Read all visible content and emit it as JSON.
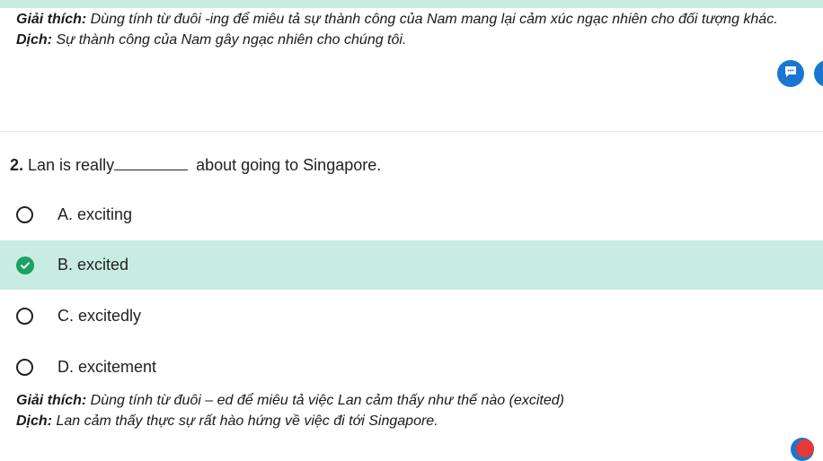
{
  "previous": {
    "explanation_label": "Giải thích:",
    "explanation_text": " Dùng tính từ đuôi -ing để miêu tả sự thành công của Nam mang lại cảm xúc ngạc nhiên cho đối tượng khác.",
    "translation_label": "Dịch:",
    "translation_text": " Sự thành công của Nam gây ngạc nhiên cho chúng tôi."
  },
  "question": {
    "number": "2.",
    "text_before": " Lan is really",
    "text_after": " about going to Singapore.",
    "options": [
      {
        "label": "A. exciting",
        "selected": false
      },
      {
        "label": "B. excited",
        "selected": true
      },
      {
        "label": "C. excitedly",
        "selected": false
      },
      {
        "label": "D. excitement",
        "selected": false
      }
    ],
    "explanation_label": "Giải thích:",
    "explanation_text": " Dùng tính từ đuôi – ed để miêu tả việc Lan cảm thấy như thế nào (excited)",
    "translation_label": "Dịch:",
    "translation_text": " Lan cảm thấy thực sự rất hào hứng về việc đi tới Singapore."
  },
  "icons": {
    "chat": "chat-bubble-icon",
    "check": "check-icon"
  },
  "colors": {
    "accent": "#1976d2",
    "correct": "#1aa163",
    "selected_bg": "#c8ece1"
  }
}
